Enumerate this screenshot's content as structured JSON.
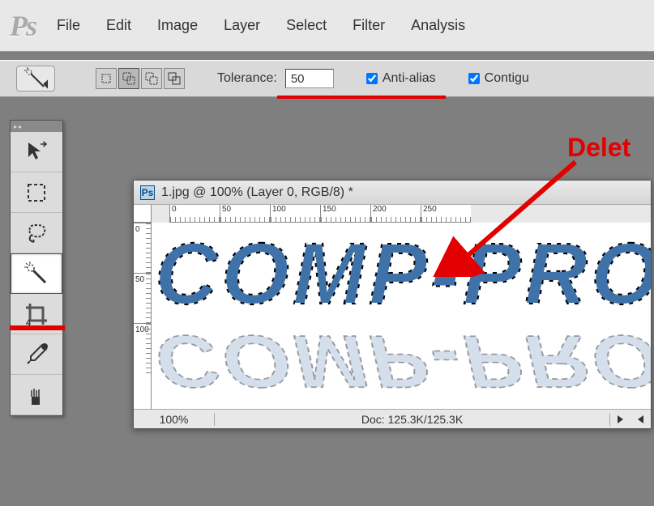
{
  "menubar": {
    "logo": "Ps",
    "items": [
      "File",
      "Edit",
      "Image",
      "Layer",
      "Select",
      "Filter",
      "Analysis"
    ]
  },
  "options": {
    "tolerance_label": "Tolerance:",
    "tolerance_value": "50",
    "antialias_label": "Anti-alias",
    "antialias_checked": true,
    "contiguous_label": "Contigu",
    "contiguous_checked": true
  },
  "tools": {
    "list": [
      {
        "name": "move-tool"
      },
      {
        "name": "marquee-tool"
      },
      {
        "name": "lasso-tool"
      },
      {
        "name": "magic-wand-tool",
        "selected": true
      },
      {
        "name": "crop-tool"
      },
      {
        "name": "eyedropper-tool"
      },
      {
        "name": "brush-tool"
      }
    ]
  },
  "document": {
    "title": "1.jpg @ 100% (Layer 0, RGB/8) *",
    "ruler_h": [
      "0",
      "50",
      "100",
      "150",
      "200",
      "250"
    ],
    "ruler_v": [
      "0",
      "50",
      "100"
    ],
    "canvas_text": "COMP-PRO",
    "zoom": "100%",
    "doc_info": "Doc: 125.3K/125.3K"
  },
  "annotation": {
    "label": "Delet"
  }
}
